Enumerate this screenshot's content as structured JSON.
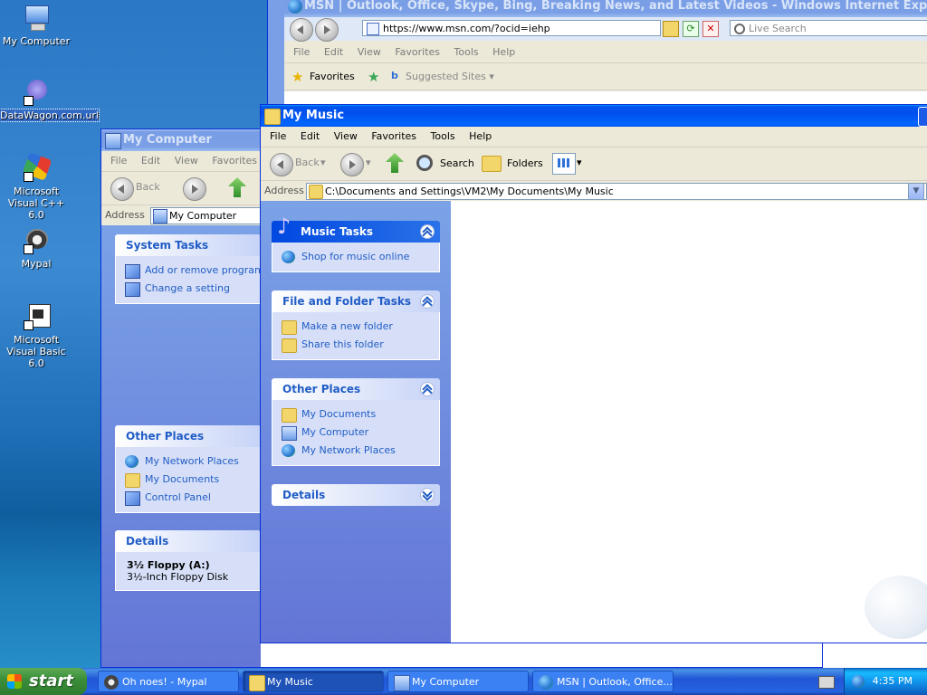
{
  "desktop": {
    "icons": [
      {
        "label": "My Computer",
        "icon": "my-computer-icon"
      },
      {
        "label": "DataWagon.com.url",
        "icon": "url-shortcut-icon"
      },
      {
        "label": "Microsoft Visual C++ 6.0",
        "icon": "visual-cpp-icon"
      },
      {
        "label": "Mypal",
        "icon": "mypal-icon"
      },
      {
        "label": "Microsoft Visual Basic 6.0",
        "icon": "visual-basic-icon"
      }
    ]
  },
  "ie_window": {
    "title": "MSN | Outlook, Office, Skype, Bing, Breaking News, and Latest Videos - Windows Internet Explorer",
    "url": "https://www.msn.com/?ocid=iehp",
    "search_placeholder": "Live Search",
    "menu": [
      "File",
      "Edit",
      "View",
      "Favorites",
      "Tools",
      "Help"
    ],
    "favorites_label": "Favorites",
    "suggested_sites_label": "Suggested Sites"
  },
  "my_computer_window": {
    "title": "My Computer",
    "menu": [
      "File",
      "Edit",
      "View",
      "Favorites"
    ],
    "back_label": "Back",
    "address_label": "Address",
    "address_value": "My Computer",
    "system_tasks": {
      "title": "System Tasks",
      "items": [
        "Add or remove programs",
        "Change a setting"
      ]
    },
    "other_places": {
      "title": "Other Places",
      "items": [
        "My Network Places",
        "My Documents",
        "Control Panel"
      ]
    },
    "details": {
      "title": "Details",
      "name": "3½ Floppy (A:)",
      "desc": "3½-Inch Floppy Disk"
    }
  },
  "my_music_window": {
    "title": "My Music",
    "menu": [
      "File",
      "Edit",
      "View",
      "Favorites",
      "Tools",
      "Help"
    ],
    "back_label": "Back",
    "search_label": "Search",
    "folders_label": "Folders",
    "address_label": "Address",
    "address_value": "C:\\Documents and Settings\\VM2\\My Documents\\My Music",
    "music_tasks": {
      "title": "Music Tasks",
      "items": [
        "Shop for music online"
      ]
    },
    "file_folder_tasks": {
      "title": "File and Folder Tasks",
      "items": [
        "Make a new folder",
        "Share this folder"
      ]
    },
    "other_places": {
      "title": "Other Places",
      "items": [
        "My Documents",
        "My Computer",
        "My Network Places"
      ]
    },
    "details": {
      "title": "Details"
    }
  },
  "taskbar": {
    "start_label": "start",
    "tasks": [
      "Oh noes! - Mypal",
      "My Music",
      "My Computer",
      "MSN | Outlook, Office..."
    ],
    "clock": "4:35 PM"
  }
}
